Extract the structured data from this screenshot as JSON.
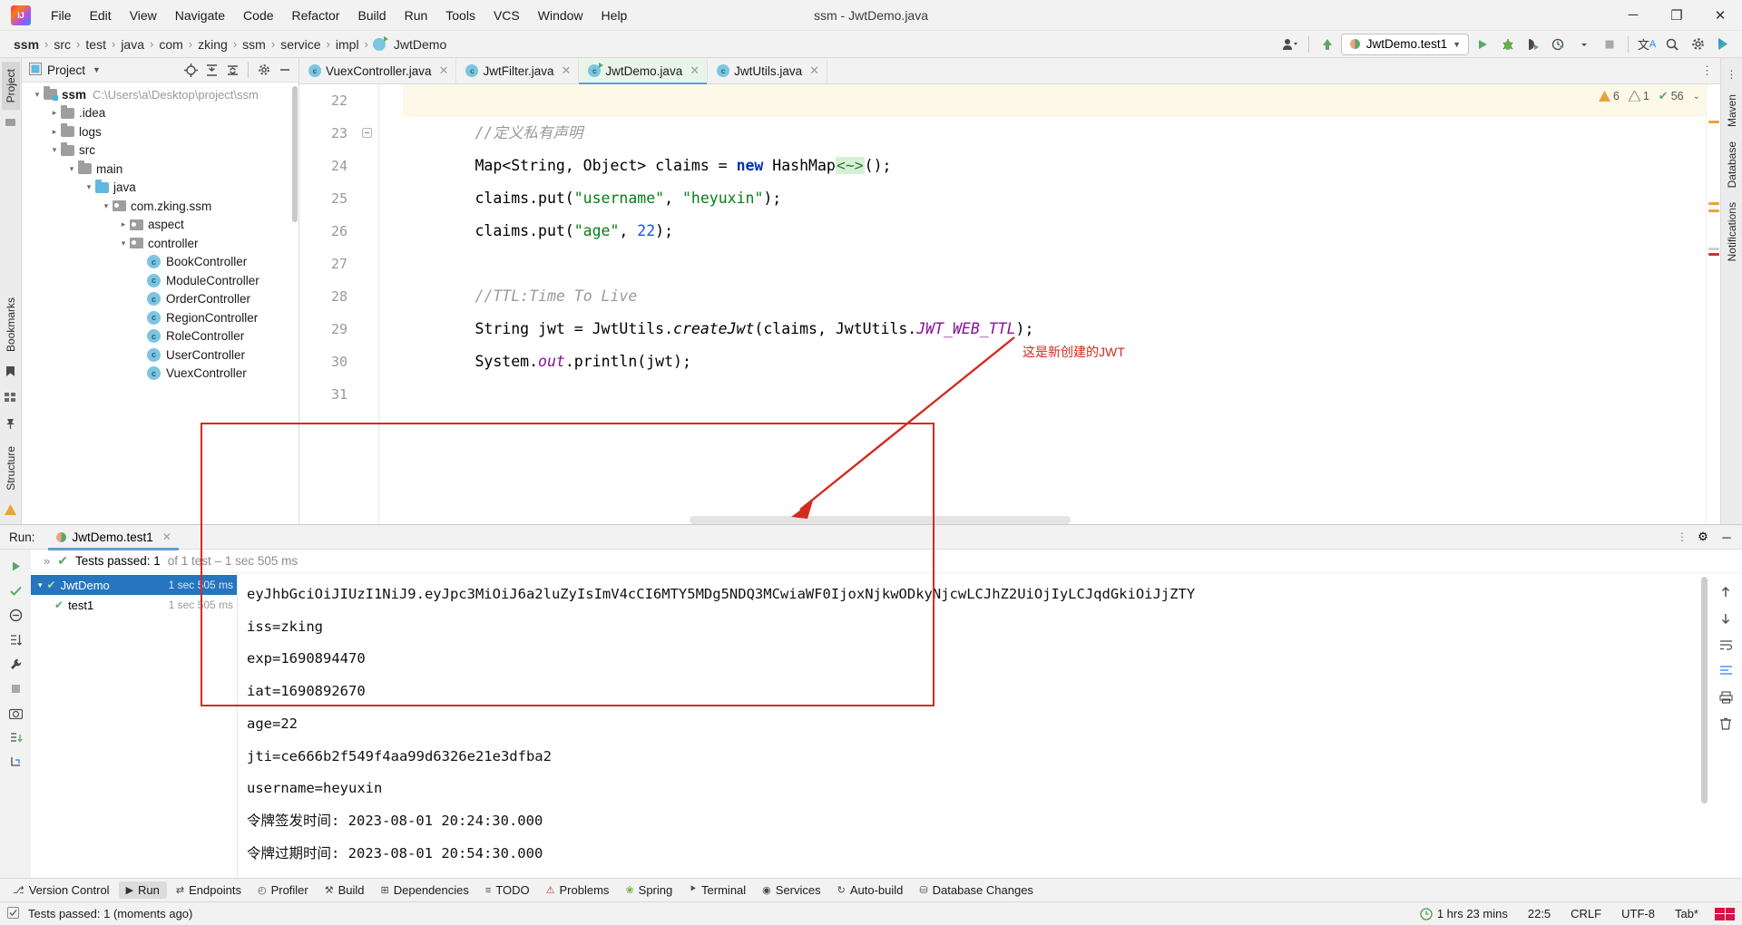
{
  "window": {
    "title": "ssm - JwtDemo.java",
    "minimize": "─",
    "maximize": "❐",
    "close": "✕"
  },
  "menubar": {
    "items": [
      {
        "label": "File"
      },
      {
        "label": "Edit"
      },
      {
        "label": "View"
      },
      {
        "label": "Navigate"
      },
      {
        "label": "Code"
      },
      {
        "label": "Refactor"
      },
      {
        "label": "Build"
      },
      {
        "label": "Run"
      },
      {
        "label": "Tools"
      },
      {
        "label": "VCS"
      },
      {
        "label": "Window"
      },
      {
        "label": "Help"
      }
    ]
  },
  "breadcrumb": {
    "items": [
      "ssm",
      "src",
      "test",
      "java",
      "com",
      "zking",
      "ssm",
      "service",
      "impl",
      "JwtDemo"
    ],
    "separator": "›"
  },
  "toolbar": {
    "run_config": "JwtDemo.test1",
    "run_config_caret": "▼",
    "icons": {
      "user": "user-icon",
      "update": "update-project-icon",
      "run": "▶",
      "debug": "debug-icon",
      "coverage": "coverage-icon",
      "profiler": "profiler-icon",
      "stop": "■",
      "translate": "translate-icon",
      "search": "search-icon",
      "settings": "⚙",
      "assistant": "ai-assistant-icon"
    }
  },
  "left_strip": {
    "project_tab": "Project",
    "bookmarks_tab": "Bookmarks",
    "structure_tab": "Structure"
  },
  "right_strip": {
    "maven_tab": "Maven",
    "database_tab": "Database",
    "notifications_tab": "Notifications"
  },
  "project_panel": {
    "title": "Project",
    "caret": "▼",
    "tree": [
      {
        "depth": 0,
        "arrow": "⌄",
        "icon": "folder-src",
        "label": "ssm",
        "bold": true,
        "path": "C:\\Users\\a\\Desktop\\project\\ssm"
      },
      {
        "depth": 1,
        "arrow": "›",
        "icon": "folder",
        "label": ".idea",
        "bold": false,
        "path": ""
      },
      {
        "depth": 1,
        "arrow": "›",
        "icon": "folder",
        "label": "logs",
        "bold": false,
        "path": ""
      },
      {
        "depth": 1,
        "arrow": "⌄",
        "icon": "folder",
        "label": "src",
        "bold": false,
        "path": ""
      },
      {
        "depth": 2,
        "arrow": "⌄",
        "icon": "folder",
        "label": "main",
        "bold": false,
        "path": ""
      },
      {
        "depth": 3,
        "arrow": "⌄",
        "icon": "folder-blue",
        "label": "java",
        "bold": false,
        "path": ""
      },
      {
        "depth": 4,
        "arrow": "⌄",
        "icon": "package",
        "label": "com.zking.ssm",
        "bold": false,
        "path": ""
      },
      {
        "depth": 5,
        "arrow": "›",
        "icon": "package",
        "label": "aspect",
        "bold": false,
        "path": ""
      },
      {
        "depth": 5,
        "arrow": "⌄",
        "icon": "package",
        "label": "controller",
        "bold": false,
        "path": ""
      },
      {
        "depth": 6,
        "arrow": "",
        "icon": "class",
        "label": "BookController",
        "bold": false,
        "path": ""
      },
      {
        "depth": 6,
        "arrow": "",
        "icon": "class",
        "label": "ModuleController",
        "bold": false,
        "path": ""
      },
      {
        "depth": 6,
        "arrow": "",
        "icon": "class",
        "label": "OrderController",
        "bold": false,
        "path": ""
      },
      {
        "depth": 6,
        "arrow": "",
        "icon": "class",
        "label": "RegionController",
        "bold": false,
        "path": ""
      },
      {
        "depth": 6,
        "arrow": "",
        "icon": "class",
        "label": "RoleController",
        "bold": false,
        "path": ""
      },
      {
        "depth": 6,
        "arrow": "",
        "icon": "class",
        "label": "UserController",
        "bold": false,
        "path": ""
      },
      {
        "depth": 6,
        "arrow": "",
        "icon": "class",
        "label": "VuexController",
        "bold": false,
        "path": ""
      }
    ]
  },
  "editor": {
    "tabs": [
      {
        "label": "VuexController.java",
        "active": false,
        "running": false
      },
      {
        "label": "JwtFilter.java",
        "active": false,
        "running": false
      },
      {
        "label": "JwtDemo.java",
        "active": true,
        "running": true
      },
      {
        "label": "JwtUtils.java",
        "active": false,
        "running": false
      }
    ],
    "close_glyph": "✕",
    "inspections": {
      "errors": "6",
      "warnings": "1",
      "checks": "56",
      "error_glyph": "⚠",
      "warning_glyph": "⚠",
      "check_glyph": "✔",
      "caret": "⌄"
    },
    "lines": [
      {
        "num": "22",
        "highlight": true,
        "fold": false,
        "tokens": []
      },
      {
        "num": "23",
        "highlight": false,
        "fold": true,
        "tokens": [
          {
            "t": "        ",
            "c": ""
          },
          {
            "t": "//定义私有声明",
            "c": "k-comment"
          }
        ]
      },
      {
        "num": "24",
        "highlight": false,
        "fold": false,
        "tokens": [
          {
            "t": "        Map<String, Object> claims = ",
            "c": ""
          },
          {
            "t": "new",
            "c": "k-kw"
          },
          {
            "t": " HashMap",
            "c": ""
          },
          {
            "t": "<~>",
            "c": "k-hint"
          },
          {
            "t": "();",
            "c": ""
          }
        ]
      },
      {
        "num": "25",
        "highlight": false,
        "fold": false,
        "tokens": [
          {
            "t": "        claims.put(",
            "c": ""
          },
          {
            "t": "\"username\"",
            "c": "k-str"
          },
          {
            "t": ", ",
            "c": ""
          },
          {
            "t": "\"heyuxin\"",
            "c": "k-str"
          },
          {
            "t": ");",
            "c": ""
          }
        ]
      },
      {
        "num": "26",
        "highlight": false,
        "fold": false,
        "tokens": [
          {
            "t": "        claims.put(",
            "c": ""
          },
          {
            "t": "\"age\"",
            "c": "k-str"
          },
          {
            "t": ", ",
            "c": ""
          },
          {
            "t": "22",
            "c": "k-num"
          },
          {
            "t": ");",
            "c": ""
          }
        ]
      },
      {
        "num": "27",
        "highlight": false,
        "fold": false,
        "tokens": []
      },
      {
        "num": "28",
        "highlight": false,
        "fold": false,
        "tokens": [
          {
            "t": "        ",
            "c": ""
          },
          {
            "t": "//TTL:Time To Live",
            "c": "k-comment"
          }
        ]
      },
      {
        "num": "29",
        "highlight": false,
        "fold": false,
        "tokens": [
          {
            "t": "        String jwt = JwtUtils.",
            "c": ""
          },
          {
            "t": "createJwt",
            "c": "k-mth"
          },
          {
            "t": "(claims, JwtUtils.",
            "c": ""
          },
          {
            "t": "JWT_WEB_TTL",
            "c": "k-fld"
          },
          {
            "t": ");",
            "c": ""
          }
        ]
      },
      {
        "num": "30",
        "highlight": false,
        "fold": false,
        "tokens": [
          {
            "t": "        System.",
            "c": ""
          },
          {
            "t": "out",
            "c": "k-fld"
          },
          {
            "t": ".println(jwt);",
            "c": ""
          }
        ]
      },
      {
        "num": "31",
        "highlight": false,
        "fold": false,
        "tokens": []
      }
    ]
  },
  "run_panel": {
    "label": "Run:",
    "tab_label": "JwtDemo.test1",
    "tab_close": "✕",
    "status": {
      "check": "✔",
      "passed_text": "Tests passed: 1",
      "detail": "of 1 test – 1 sec 505 ms"
    },
    "chevrons": "»",
    "tests": [
      {
        "label": "JwtDemo",
        "time": "1 sec 505 ms",
        "selected": true,
        "depth": 0
      },
      {
        "label": "test1",
        "time": "1 sec 505 ms",
        "selected": false,
        "depth": 1
      }
    ],
    "console_lines": [
      "eyJhbGciOiJIUzI1NiJ9.eyJpc3MiOiJ6a2luZyIsImV4cCI6MTY5MDg5NDQ3MCwiaWF0IjoxNjkwODkyNjcwLCJhZ2UiOjIyLCJqdGkiOiJjZTY",
      "iss=zking",
      "exp=1690894470",
      "iat=1690892670",
      "age=22",
      "jti=ce666b2f549f4aa99d6326e21e3dfba2",
      "username=heyuxin",
      "令牌签发时间: 2023-08-01 20:24:30.000",
      "令牌过期时间: 2023-08-01 20:54:30.000"
    ],
    "toolbar_icons": [
      "rerun-icon",
      "rerun-failed-icon",
      "toggle-auto-test-icon",
      "wrench-icon",
      "pause-icon",
      "camera-icon",
      "export-icon",
      "import-icon"
    ],
    "console_icons": [
      "scroll-up-icon",
      "scroll-down-icon",
      "wrap-text-icon",
      "scroll-to-end-icon",
      "print-icon",
      "trash-icon"
    ],
    "settings_glyph": "⚙",
    "minimize_glyph": "─"
  },
  "annotation": {
    "text": "这是新创建的JWT",
    "color": "#d42b1f"
  },
  "bottom_bar": {
    "items": [
      {
        "label": "Version Control",
        "icon": "branch-icon",
        "active": false
      },
      {
        "label": "Run",
        "icon": "run-icon",
        "active": true
      },
      {
        "label": "Endpoints",
        "icon": "endpoints-icon",
        "active": false
      },
      {
        "label": "Profiler",
        "icon": "profiler-icon",
        "active": false
      },
      {
        "label": "Build",
        "icon": "hammer-icon",
        "active": false
      },
      {
        "label": "Dependencies",
        "icon": "dependencies-icon",
        "active": false
      },
      {
        "label": "TODO",
        "icon": "todo-icon",
        "active": false
      },
      {
        "label": "Problems",
        "icon": "problems-icon",
        "active": false
      },
      {
        "label": "Spring",
        "icon": "spring-icon",
        "active": false
      },
      {
        "label": "Terminal",
        "icon": "terminal-icon",
        "active": false
      },
      {
        "label": "Services",
        "icon": "services-icon",
        "active": false
      },
      {
        "label": "Auto-build",
        "icon": "autobuild-icon",
        "active": false
      },
      {
        "label": "Database Changes",
        "icon": "database-icon",
        "active": false
      }
    ]
  },
  "statusbar": {
    "message": "Tests passed: 1 (moments ago)",
    "clock_icon": "◴",
    "time_spent": "1 hrs 23 mins",
    "caret_pos": "22:5",
    "line_sep": "CRLF",
    "encoding": "UTF-8",
    "indent": "Tab*",
    "memory": "memory-indicator"
  }
}
